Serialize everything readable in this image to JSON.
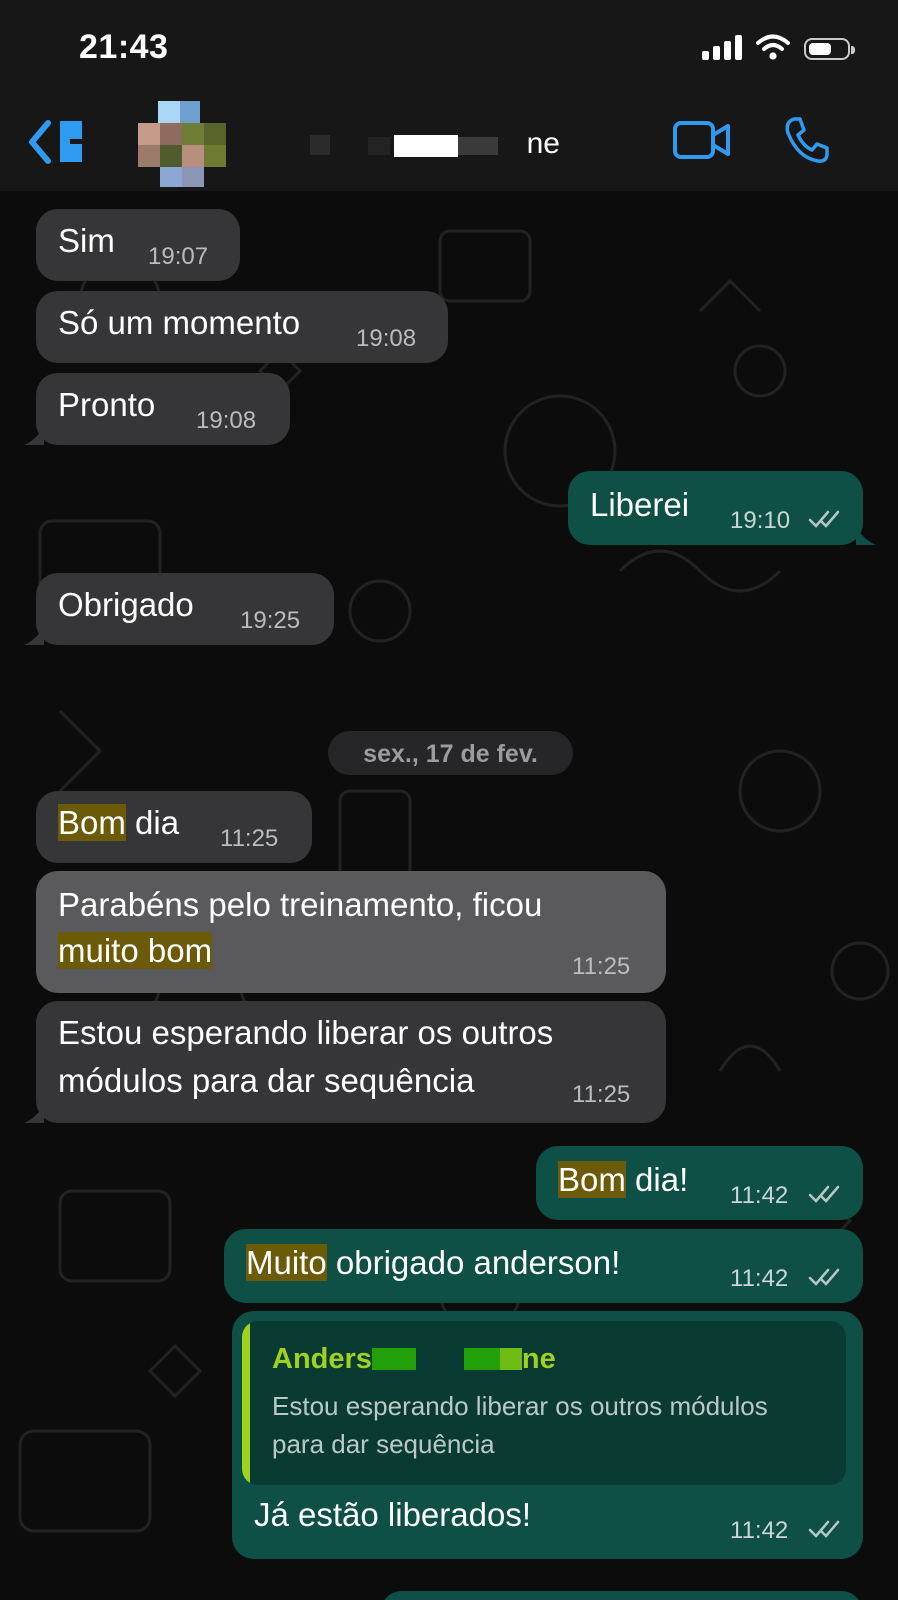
{
  "status_bar": {
    "time": "21:43"
  },
  "header": {
    "contact_name_visible_suffix": "ne",
    "icons": {
      "back": "chevron-left-icon",
      "video": "video-camera-icon",
      "call": "phone-icon"
    }
  },
  "colors": {
    "incoming_bubble": "#363638",
    "outgoing_bubble": "#0e5046",
    "accent_blue": "#2f9bf0",
    "highlight": "#6b5a08",
    "quote_bar": "#9fd11f"
  },
  "messages": [
    {
      "direction": "in",
      "text": "Sim",
      "time": "19:07"
    },
    {
      "direction": "in",
      "text": "Só um momento",
      "time": "19:08"
    },
    {
      "direction": "in",
      "text": "Pronto",
      "time": "19:08"
    },
    {
      "direction": "out",
      "text": "Liberei",
      "time": "19:10",
      "status": "read"
    },
    {
      "direction": "in",
      "text": "Obrigado",
      "time": "19:25"
    },
    {
      "direction": "in",
      "text_highlight": "Bom",
      "text_rest": " dia",
      "time": "11:25"
    },
    {
      "direction": "in",
      "line1": "Parabéns pelo treinamento, ficou",
      "line2_highlight": "muito bom",
      "time": "11:25"
    },
    {
      "direction": "in",
      "line1": "Estou esperando liberar os outros",
      "line2": "módulos para dar sequência",
      "time": "11:25"
    },
    {
      "direction": "out",
      "text_highlight": "Bom",
      "text_rest": " dia!",
      "time": "11:42",
      "status": "read"
    },
    {
      "direction": "out",
      "text_highlight": "Muito",
      "text_rest": " obrigado anderson!",
      "time": "11:42",
      "status": "read"
    },
    {
      "direction": "out",
      "reply": {
        "name_prefix": "Anders",
        "name_suffix": "ne",
        "line1": "Estou esperando liberar os outros módulos",
        "line2": "para dar sequência"
      },
      "text": "Já estão liberados!",
      "time": "11:42",
      "status": "read"
    }
  ],
  "date_separator": "sex., 17 de fev."
}
